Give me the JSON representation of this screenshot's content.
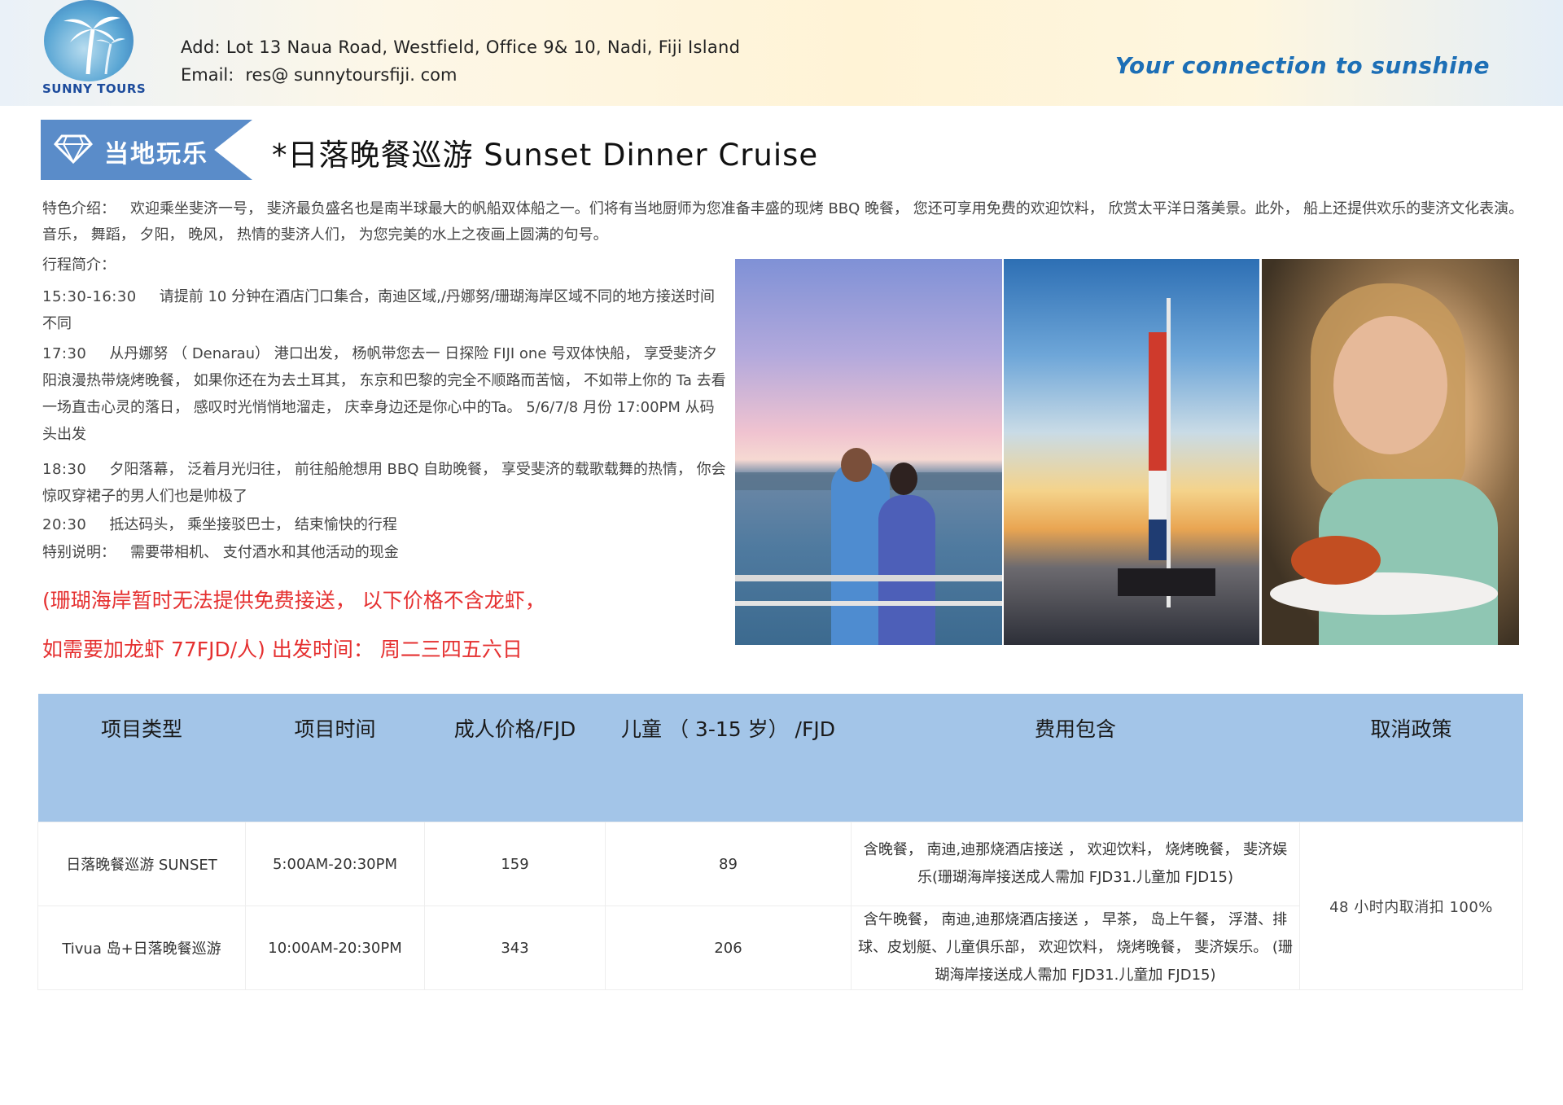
{
  "header": {
    "logo_text": "SUNNY TOURS",
    "address": "Add:  Lot 13  Naua Road,  Westfield,  Office 9& 10,  Nadi,  Fiji Island",
    "email_label": "Email:",
    "email_value": "res@ sunnytoursfiji. com",
    "slogan": "Your connection to sunshine"
  },
  "title": {
    "tag": "当地玩乐",
    "text": "*日落晚餐巡游  Sunset  Dinner  Cruise"
  },
  "intro": {
    "label": "特色介绍：",
    "text": "欢迎乘坐斐济一号，  斐济最负盛名也是南半球最大的帆船双体船之一。们将有当地厨师为您准备丰盛的现烤 BBQ 晚餐，   您还可享用免费的欢迎饮料，   欣赏太平洋日落美景。此外，   船上还提供欢乐的斐济文化表演。  音乐，    舞蹈，    夕阳，    晚风，    热情的斐济人们，    为您完美的水上之夜画上圆满的句号。"
  },
  "itinerary": {
    "label": "行程简介：",
    "items": [
      {
        "time": "15:30-16:30",
        "text": "请提前 10 分钟在酒店门口集合，南迪区域,/丹娜努/珊瑚海岸区域不同的地方接送时间不同"
      },
      {
        "time": "17:30",
        "text": "从丹娜努  （ Denarau） 港口出发，   杨帆带您去一 日探险  FIJI one 号双体快船，   享受斐济夕阳浪漫热带烧烤晚餐，  如果你还在为去土耳其，   东京和巴黎的完全不顺路而苦恼，  不如带上你的 Ta 去看一场直击心灵的落日，   感叹时光悄悄地溜走，   庆幸身边还是你心中的Ta。 5/6/7/8 月份 17:00PM 从码头出发"
      },
      {
        "time": "18:30",
        "text": "夕阳落幕，   泛着月光归往，    前往船舱想用  BBQ 自助晚餐，    享受斐济的载歌载舞的热情，    你会惊叹穿裙子的男人们也是帅极了"
      },
      {
        "time": "20:30",
        "text": "抵达码头，    乘坐接驳巴士，     结束愉快的行程"
      }
    ]
  },
  "special": {
    "label": "特别说明：",
    "text": "需要带相机、    支付酒水和其他活动的现金"
  },
  "notice": {
    "line1": "(珊瑚海岸暂时无法提供免费接送，    以下价格不含龙虾，",
    "line2": "如需要加龙虾  77FJD/人)   出发时间：    周二三四五六日"
  },
  "table": {
    "headers": [
      "项目类型",
      "项目时间",
      "成人价格/FJD",
      "儿童 （ 3-15 岁） /FJD",
      "费用包含",
      "取消政策"
    ],
    "rows": [
      {
        "type": "日落晚餐巡游    SUNSET",
        "time": "5:00AM-20:30PM",
        "adult": "159",
        "child": "89",
        "includes": "含晚餐，    南迪,迪那烧酒店接送   ，    欢迎饮料，    烧烤晚餐，   斐济娱乐(珊瑚海岸接送成人需加  FJD31.儿童加  FJD15)"
      },
      {
        "type": "Tivua 岛+日落晚餐巡游",
        "time": "10:00AM-20:30PM",
        "adult": "343",
        "child": "206",
        "includes": "含午晚餐，    南迪,迪那烧酒店接送   ，    早茶，    岛上午餐，    浮潜、排球、皮划艇、儿童俱乐部，   欢迎饮料，    烧烤晚餐，    斐济娱乐。  (珊瑚海岸接送成人需加 FJD31.儿童加 FJD15)"
      }
    ],
    "cancel_policy": "48 小时内取消扣 100%"
  },
  "photos": [
    {
      "name": "couple-sunset-photo"
    },
    {
      "name": "catamaran-sunset-photo"
    },
    {
      "name": "lobster-dinner-photo"
    }
  ],
  "colors": {
    "header_blue": "#a3c5e8",
    "tag_blue": "#5a8cc9",
    "notice_red": "#e53030",
    "slogan_blue": "#1d6fb6"
  }
}
